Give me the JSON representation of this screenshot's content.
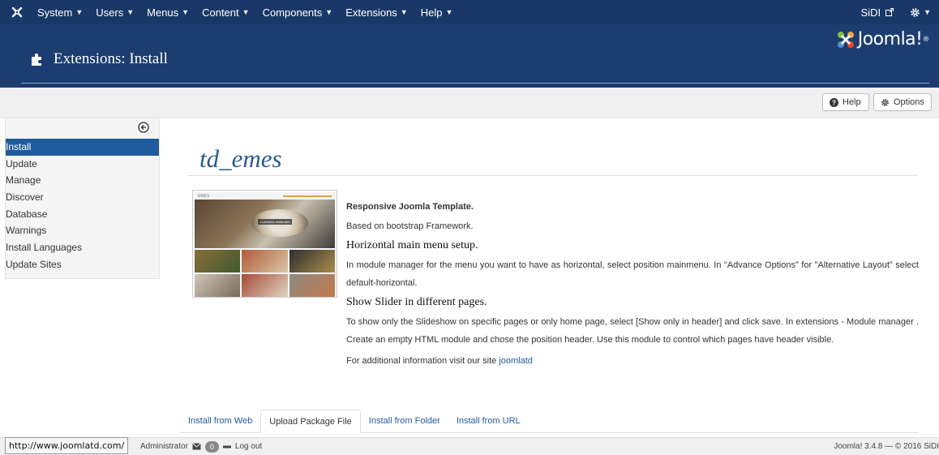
{
  "topbar": {
    "menus": [
      "System",
      "Users",
      "Menus",
      "Content",
      "Components",
      "Extensions",
      "Help"
    ],
    "site_link": "SiDI",
    "icons": {
      "brand": "joomla-icon",
      "external": "external-link-icon",
      "settings": "gear-icon",
      "caret": "caret-down-icon"
    }
  },
  "header": {
    "title": "Extensions: Install",
    "brand": "Joomla!",
    "brand_mark": "®"
  },
  "toolbar": {
    "help_label": "Help",
    "options_label": "Options"
  },
  "sidebar": {
    "items": [
      "Install",
      "Update",
      "Manage",
      "Discover",
      "Database",
      "Warnings",
      "Install Languages",
      "Update Sites"
    ],
    "active": "Install"
  },
  "extension": {
    "name": "td_emes",
    "thumb_header": "EMES",
    "thumb_caption": "Luxurious restaurant"
  },
  "description": {
    "heading1": "Responsive Joomla Template.",
    "line1": "Based on bootstrap Framework.",
    "heading2": "Horizontal main menu setup.",
    "para2": "In module manager for the menu you want to have as horizontal, select position mainmenu. In \"Advance Options\" for \"Alternative Layout\" select default-horizontal.",
    "heading3": "Show Slider in different pages.",
    "para3": "To show only the Slideshow on specific pages or only home page, select [Show only in header] and click save. In extensions - Module manager . Create an empty HTML module and chose the position header. Use this module to control which pages have header visible.",
    "more_prefix": "For additional information visit our site ",
    "more_link": "joomlatd"
  },
  "tabs": [
    "Install from Web",
    "Upload Package File",
    "Install from Folder",
    "Install from URL"
  ],
  "active_tab": "Upload Package File",
  "statusbar": {
    "url_tooltip": "http://www.joomlatd.com/",
    "admin_label": "Administrator",
    "message_count": "0",
    "logout_label": "Log out",
    "copyright": "Joomla! 3.4.8 — © 2016 SiDI"
  },
  "colors": {
    "topbar": "#1a3867",
    "header": "#1c3d6f",
    "active": "#1f5c9e",
    "link": "#1f5c9e"
  }
}
